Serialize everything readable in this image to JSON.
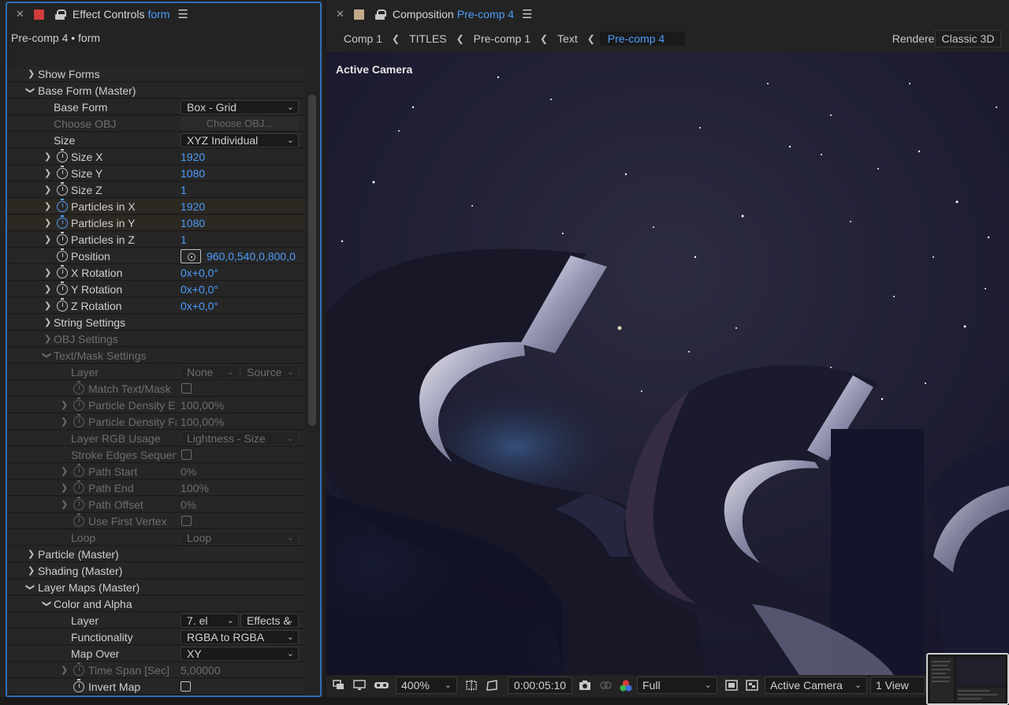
{
  "colors": {
    "accent": "#4d9dfc",
    "tab_red": "#d03b3b",
    "tab_tan": "#c2a98a",
    "panel_border": "#2f6fb3"
  },
  "effect_controls": {
    "tab_label": "Effect Controls",
    "tab_target": "form",
    "subtitle": "Pre-comp 4 • form",
    "rows": [
      {
        "label": "Show Forms",
        "twirl": "right"
      },
      {
        "label": "Base Form (Master)",
        "twirl": "down"
      },
      {
        "label": "Base Form",
        "dropdown": "Box - Grid"
      },
      {
        "label": "Choose OBJ",
        "button": "Choose OBJ...",
        "dim": true
      },
      {
        "label": "Size",
        "dropdown": "XYZ Individual"
      },
      {
        "label": "Size X",
        "value": "1920"
      },
      {
        "label": "Size Y",
        "value": "1080"
      },
      {
        "label": "Size Z",
        "value": "1"
      },
      {
        "label": "Particles in X",
        "value": "1920"
      },
      {
        "label": "Particles in Y",
        "value": "1080"
      },
      {
        "label": "Particles in Z",
        "value": "1"
      },
      {
        "label": "Position",
        "value": "960,0,540,0,800,0"
      },
      {
        "label": "X Rotation",
        "value": "0x+0,0°"
      },
      {
        "label": "Y Rotation",
        "value": "0x+0,0°"
      },
      {
        "label": "Z Rotation",
        "value": "0x+0,0°"
      },
      {
        "label": "String Settings"
      },
      {
        "label": "OBJ Settings"
      },
      {
        "label": "Text/Mask Settings"
      },
      {
        "label": "Layer",
        "dropdown": "None",
        "dropdown2": "Source"
      },
      {
        "label": "Match Text/Mask"
      },
      {
        "label": "Particle Density E",
        "value": "100,00%"
      },
      {
        "label": "Particle Density Fa",
        "value": "100,00%"
      },
      {
        "label": "Layer RGB Usage",
        "dropdown": "Lightness - Size"
      },
      {
        "label": "Stroke Edges Sequenti"
      },
      {
        "label": "Path Start",
        "value": "0%"
      },
      {
        "label": "Path End",
        "value": "100%"
      },
      {
        "label": "Path Offset",
        "value": "0%"
      },
      {
        "label": "Use First Vertex"
      },
      {
        "label": "Loop",
        "dropdown": "Loop"
      },
      {
        "label": "Particle (Master)"
      },
      {
        "label": "Shading (Master)"
      },
      {
        "label": "Layer Maps (Master)"
      },
      {
        "label": "Color and Alpha"
      },
      {
        "label": "Layer",
        "dropdown": "7. el",
        "dropdown2": "Effects &"
      },
      {
        "label": "Functionality",
        "dropdown": "RGBA to RGBA"
      },
      {
        "label": "Map Over",
        "dropdown": "XY"
      },
      {
        "label": "Time Span [Sec]",
        "value": "5,00000"
      },
      {
        "label": "Invert Map"
      }
    ]
  },
  "composition": {
    "tab_label": "Composition",
    "tab_target": "Pre-comp 4",
    "breadcrumbs": [
      "Comp 1",
      "TITLES",
      "Pre-comp 1",
      "Text",
      "Pre-comp 4"
    ],
    "renderer_label": "Renderer:",
    "renderer_value": "Classic 3D",
    "viewer_label": "Active Camera",
    "toolbar": {
      "zoom": "400%",
      "timecode": "0:00:05:10",
      "resolution": "Full",
      "camera": "Active Camera",
      "views": "1 View"
    }
  }
}
